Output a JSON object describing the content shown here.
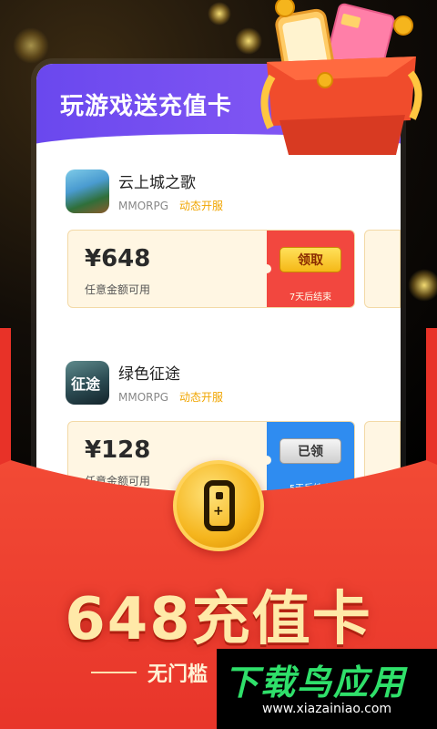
{
  "card": {
    "title": "玩游戏送充值卡"
  },
  "games": [
    {
      "name": "云上城之歌",
      "genre": "MMORPG",
      "tag": "动态开服",
      "coupon": {
        "amount": "¥648",
        "desc": "任意金额可用",
        "button": "领取",
        "note": "7天后结束",
        "state": "available"
      }
    },
    {
      "name": "绿色征途",
      "icon_text": "征途",
      "genre": "MMORPG",
      "tag": "动态开服",
      "coupon": {
        "amount": "¥128",
        "desc": "任意金额可用",
        "button": "已领",
        "note": "5天后结束",
        "state": "claimed"
      }
    }
  ],
  "promo": {
    "big_title": "648充值卡",
    "subtitle": "无门槛"
  },
  "watermark": {
    "text": "下载鸟应用",
    "url": "www.xiazainiao.com"
  },
  "colors": {
    "header_purple": "#6a48ee",
    "envelope_red": "#ee3c2c",
    "coupon_red": "#f2473f",
    "coupon_blue": "#2f8cf0",
    "gold": "#f5b51d",
    "watermark_green": "#2fe06a"
  },
  "icons": [
    "gift-box-icon",
    "phone-icon",
    "card-icon",
    "coin-icon",
    "phone-plus-icon"
  ]
}
